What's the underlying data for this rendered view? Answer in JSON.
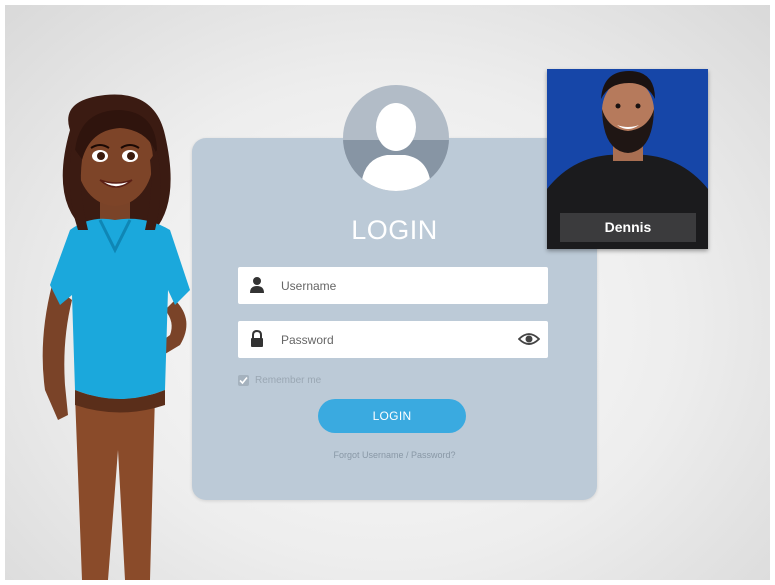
{
  "login": {
    "title": "LOGIN",
    "username_placeholder": "Username",
    "password_placeholder": "Password",
    "remember_label": "Remember me",
    "remember_checked": true,
    "button_label": "LOGIN",
    "forgot_link": "Forgot Username / Password?"
  },
  "presenter": {
    "name": "Dennis"
  },
  "icons": {
    "username": "user-icon",
    "password": "lock-icon",
    "show_password": "eye-icon",
    "avatar": "user-avatar-icon"
  },
  "colors": {
    "card": "#bccad7",
    "button": "#3aaae0",
    "photo_background": "#1646a8"
  }
}
